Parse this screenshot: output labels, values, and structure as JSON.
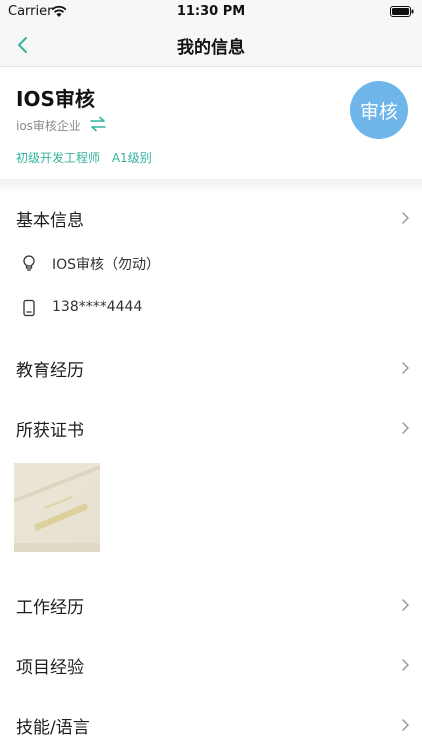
{
  "status_bar": {
    "carrier": "Carrier",
    "time": "11:30 PM"
  },
  "nav": {
    "title": "我的信息"
  },
  "profile": {
    "name": "IOS审核",
    "company": "ios审核企业",
    "tags": [
      "初级开发工程师",
      "A1级别"
    ],
    "avatar_text": "审核"
  },
  "basic_info": {
    "title": "基本信息",
    "name_value": "IOS审核（勿动）",
    "phone_value": "138****4444"
  },
  "sections": {
    "education": "教育经历",
    "certificates": "所获证书",
    "work": "工作经历",
    "projects": "项目经验",
    "skills": "技能/语言"
  },
  "colors": {
    "accent": "#32b59c",
    "avatar_bg": "#6eb5ea",
    "nav_bg": "#f7f7f7"
  },
  "icons": {
    "back": "chevron-left-icon",
    "switch": "swap-icon",
    "name": "lightbulb-icon",
    "phone": "phone-icon",
    "disclosure": "chevron-right-icon"
  }
}
